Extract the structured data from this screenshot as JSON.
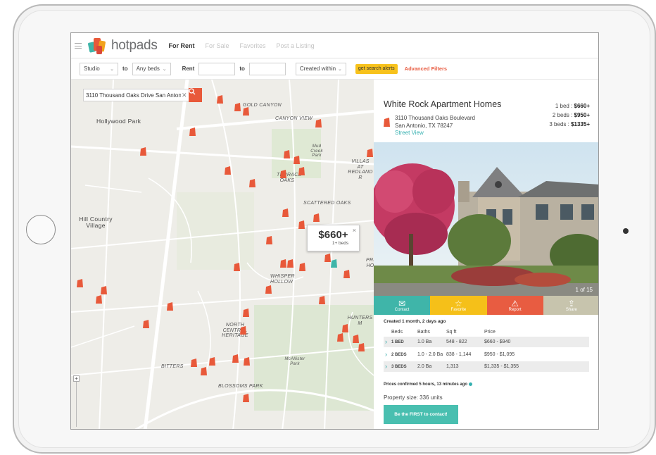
{
  "nav": {
    "logo_text": "hotpads",
    "links": [
      "For Rent",
      "For Sale",
      "Favorites",
      "Post a Listing"
    ]
  },
  "filters": {
    "beds_min": "Studio",
    "to_label": "to",
    "beds_max": "Any beds",
    "rent_label": "Rent",
    "rent_to_label": "to",
    "created_within": "Created within",
    "search_alerts": "get search alerts",
    "advanced": "Advanced Filters"
  },
  "search": {
    "value": "3110 Thousand Oaks Drive San Antonio"
  },
  "map": {
    "areas": [
      "GOLD CANYON",
      "CANYON VIEW",
      "SCATTERED OAKS",
      "WHISPER HOLLOW",
      "NORTH CENTRAL HERITAGE",
      "BITTERS",
      "BLOSSOMS PARK",
      "HUNTERS M",
      "TERRACE OAKS",
      "VILLAS AT REDLAND R",
      "PRE HO"
    ],
    "places": [
      "Hollywood Park",
      "Hill Country Village"
    ],
    "parks": [
      "Mud Creek Park",
      "McAllister Park"
    ],
    "popup_price": "$660+",
    "popup_beds": "1+ beds",
    "popup_close": "×"
  },
  "listing": {
    "title": "White Rock Apartment Homes",
    "address_line1": "3110 Thousand Oaks Boulevard",
    "address_line2": "San Antonio, TX 78247",
    "street_view": "Street View",
    "prices": [
      {
        "label": "1 bed :",
        "value": "$660+"
      },
      {
        "label": "2 beds :",
        "value": "$950+"
      },
      {
        "label": "3 beds :",
        "value": "$1335+"
      }
    ],
    "photo_count": "1 of 15",
    "actions": [
      {
        "label": "Contact",
        "color": "#3fb5a9"
      },
      {
        "label": "Favorite",
        "color": "#f5c019"
      },
      {
        "label": "Report",
        "color": "#e85c41"
      },
      {
        "label": "Share",
        "color": "#c7c4ad"
      }
    ],
    "created": "Created 1 month, 2 days ago",
    "table": {
      "headers": [
        "Beds",
        "Baths",
        "Sq ft",
        "Price"
      ],
      "rows": [
        [
          "1 BED",
          "1.0 Ba",
          "548 - 822",
          "$660 - $940"
        ],
        [
          "2 BEDS",
          "1.0 - 2.0 Ba",
          "838 - 1,144",
          "$950 - $1,095"
        ],
        [
          "3 BEDS",
          "2.0 Ba",
          "1,313",
          "$1,335 - $1,355"
        ]
      ]
    },
    "confirmed": "Prices confirmed 5 hours, 13 minutes ago",
    "property_size": "Property size: 336 units",
    "contact_button": "Be the FIRST to contact!"
  }
}
